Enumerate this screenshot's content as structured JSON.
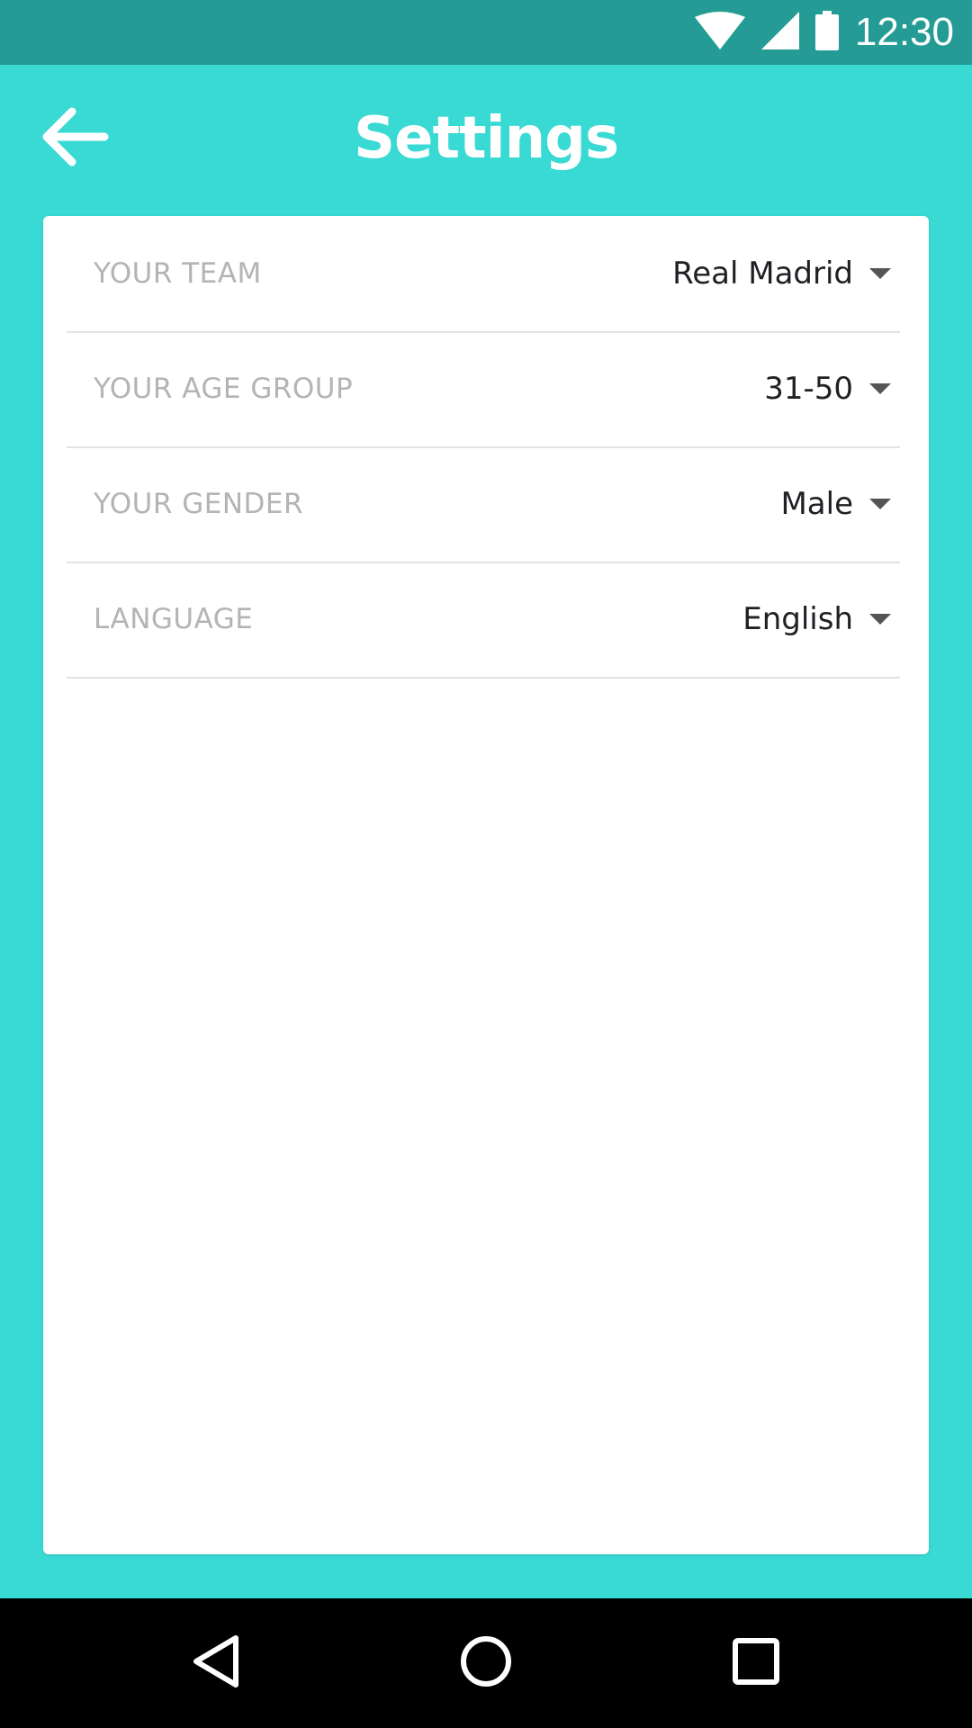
{
  "status_bar": {
    "time": "12:30",
    "icons": [
      "wifi-icon",
      "cell-signal-icon",
      "battery-icon"
    ]
  },
  "app_bar": {
    "title": "Settings",
    "back_icon": "arrow-back-icon"
  },
  "settings": [
    {
      "label": "YOUR TEAM",
      "value": "Real Madrid"
    },
    {
      "label": "YOUR AGE GROUP",
      "value": "31-50"
    },
    {
      "label": "YOUR GENDER",
      "value": "Male"
    },
    {
      "label": "LANGUAGE",
      "value": "English"
    }
  ],
  "nav_bar": {
    "icons": [
      "back-triangle-icon",
      "home-circle-icon",
      "recents-square-icon"
    ]
  },
  "colors": {
    "accent": "#39D9D4",
    "status_bar": "#259B95",
    "label": "#B4B4B4",
    "value": "#1F1F24"
  }
}
